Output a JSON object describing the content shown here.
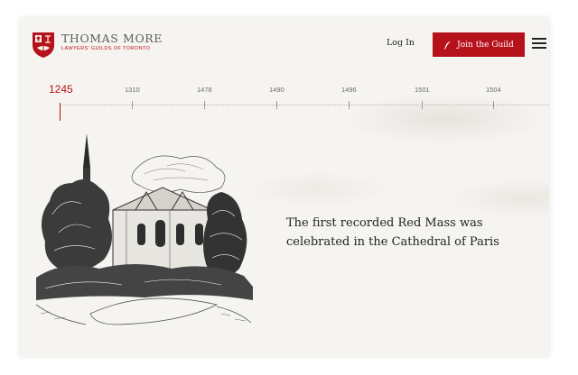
{
  "brand": {
    "title": "THOMAS MORE",
    "subtitle": "LAWYERS' GUILDS OF TORONTO",
    "accent_color": "#b5121b"
  },
  "header": {
    "login_label": "Log In",
    "join_label": "Join the Guild",
    "join_icon": "quill-icon",
    "menu_icon": "hamburger-menu-icon"
  },
  "timeline": {
    "active_year": "1245",
    "years": [
      "1310",
      "1478",
      "1490",
      "1496",
      "1501",
      "1504"
    ]
  },
  "event": {
    "caption": "The first recorded Red Mass was celebrated in the Cathedral of Paris",
    "illustration": "cathedral-engraving"
  }
}
